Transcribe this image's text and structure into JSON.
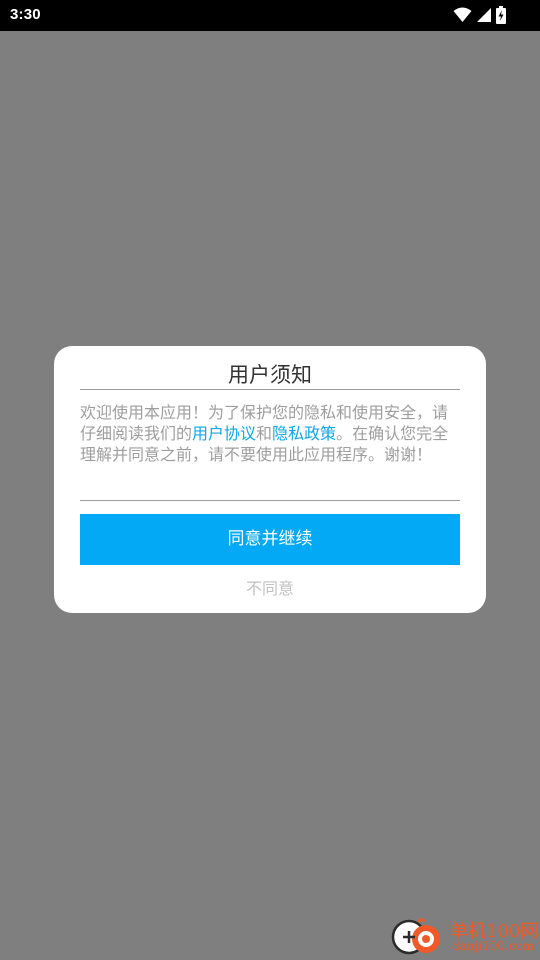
{
  "status_bar": {
    "time": "3:30"
  },
  "dialog": {
    "title": "用户须知",
    "body": {
      "part1": "欢迎使用本应用！为了保护您的隐私和使用安全，请仔细阅读我们的",
      "link1": "用户协议",
      "and": "和",
      "link2": "隐私政策",
      "part2": "。在确认您完全理解并同意之前，请不要使用此应用程序。谢谢！"
    },
    "agree_label": "同意并继续",
    "disagree_label": "不同意"
  },
  "watermark": {
    "text_cn": "单机100网",
    "text_en": "danji100.com"
  },
  "colors": {
    "status_bar": "#000000",
    "overlay": "#7f7f7f",
    "dialog_bg": "#ffffff",
    "accent": "#03a9f4",
    "link": "#11a6e8",
    "body_text": "#9e9e9e",
    "watermark": "#f05a28"
  },
  "icons": {
    "status": [
      "wifi-icon",
      "cell-signal-icon",
      "battery-charging-icon"
    ]
  }
}
